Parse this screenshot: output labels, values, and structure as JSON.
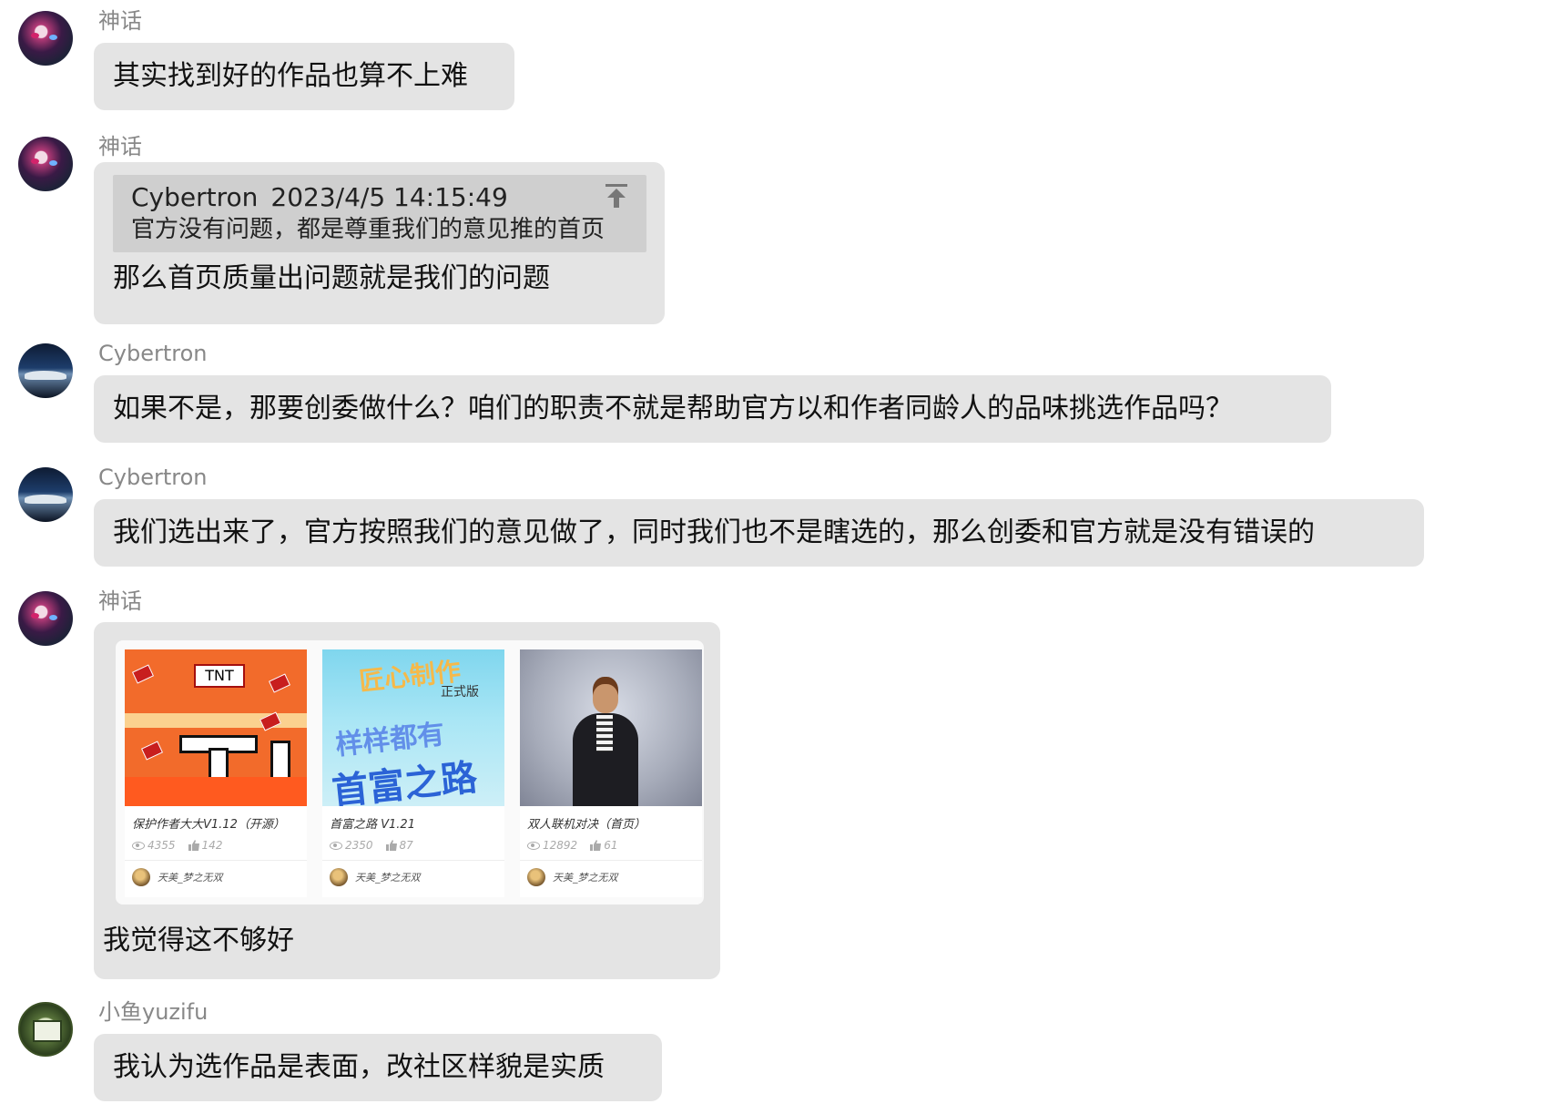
{
  "messages": [
    {
      "sender": "神话",
      "avatar": "anime-avatar",
      "text": "其实找到好的作品也算不上难"
    },
    {
      "sender": "神话",
      "avatar": "anime-avatar",
      "quote": {
        "author": "Cybertron",
        "time": "2023/4/5 14:15:49",
        "text": "官方没有问题，都是尊重我们的意见推的首页"
      },
      "text": "那么首页质量出问题就是我们的问题"
    },
    {
      "sender": "Cybertron",
      "avatar": "car-avatar",
      "text": "如果不是，那要创委做什么？咱们的职责不就是帮助官方以和作者同龄人的品味挑选作品吗？"
    },
    {
      "sender": "Cybertron",
      "avatar": "car-avatar",
      "text": "我们选出来了，官方按照我们的意见做了，同时我们也不是瞎选的，那么创委和官方就是没有错误的"
    },
    {
      "sender": "神话",
      "avatar": "anime-avatar",
      "cards": [
        {
          "title": "保护作者大大V1.12（开源）",
          "views": "4355",
          "likes": "142",
          "author": "天美_梦之无双",
          "cover_text": {
            "tnt": "TNT"
          }
        },
        {
          "title": "首富之路 V1.21",
          "views": "2350",
          "likes": "87",
          "author": "天美_梦之无双",
          "cover_text": {
            "line1": "匠心制作",
            "line2": "正式版",
            "line3": "样样都有",
            "line4": "首富之路"
          }
        },
        {
          "title": "双人联机对决（首页）",
          "views": "12892",
          "likes": "61",
          "author": "天美_梦之无双"
        }
      ],
      "text": "我觉得这不够好"
    },
    {
      "sender": "小鱼yuzifu",
      "avatar": "green-avatar",
      "text": "我认为选作品是表面，改社区样貌是实质"
    }
  ],
  "colors": {
    "bubble": "#e4e4e4",
    "quote": "#cfcfcf",
    "name": "#888888"
  },
  "icons": [
    "pin-top-icon",
    "eye-icon",
    "thumb-up-icon"
  ]
}
